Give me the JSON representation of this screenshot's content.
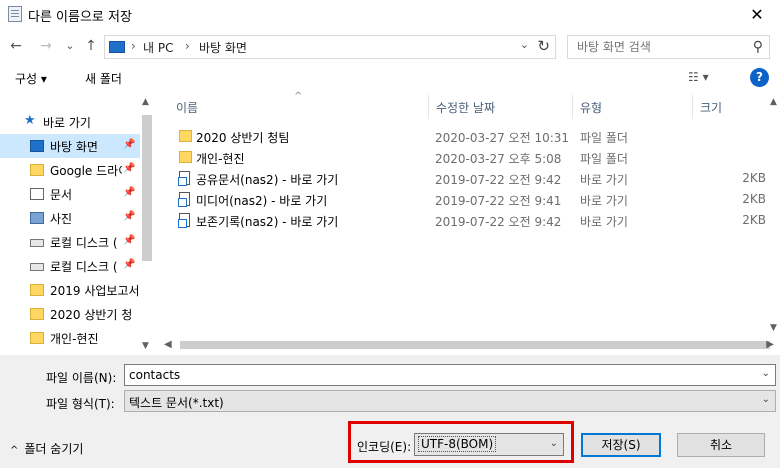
{
  "window": {
    "title": "다른 이름으로 저장",
    "close_glyph": "✕"
  },
  "nav": {
    "back": "←",
    "forward": "→",
    "recent": "⌄",
    "up": "↑",
    "breadcrumb": [
      "내 PC",
      "바탕 화면"
    ],
    "search_placeholder": "바탕 화면 검색"
  },
  "toolbar": {
    "organize": "구성 ▾",
    "new_folder": "새 폴더",
    "help": "?"
  },
  "sidebar": {
    "items": [
      {
        "label": "바로 가기",
        "icon": "quick-access-star-icon"
      },
      {
        "label": "바탕 화면",
        "icon": "desktop-icon",
        "selected": true
      },
      {
        "label": "Google 드라이",
        "icon": "folder-icon"
      },
      {
        "label": "문서",
        "icon": "documents-icon"
      },
      {
        "label": "사진",
        "icon": "pictures-icon"
      },
      {
        "label": "로컬 디스크 (",
        "icon": "drive-icon"
      },
      {
        "label": "로컬 디스크 (",
        "icon": "drive-icon"
      },
      {
        "label": "2019 사업보고서",
        "icon": "folder-icon"
      },
      {
        "label": "2020 상반기 청",
        "icon": "folder-icon"
      },
      {
        "label": "개인-현진",
        "icon": "folder-icon"
      }
    ]
  },
  "columns": {
    "name": "이름",
    "modified": "수정한 날짜",
    "type": "유형",
    "size": "크기"
  },
  "files": [
    {
      "name": "2020 상반기 청팀",
      "modified": "2020-03-27 오전 10:31",
      "type": "파일 폴더",
      "size": "",
      "icon": "folder-icon"
    },
    {
      "name": "개인-현진",
      "modified": "2020-03-27 오후 5:08",
      "type": "파일 폴더",
      "size": "",
      "icon": "folder-icon"
    },
    {
      "name": "공유문서(nas2) - 바로 가기",
      "modified": "2019-07-22 오전 9:42",
      "type": "바로 가기",
      "size": "2KB",
      "icon": "shortcut-icon"
    },
    {
      "name": "미디어(nas2) - 바로 가기",
      "modified": "2019-07-22 오전 9:41",
      "type": "바로 가기",
      "size": "2KB",
      "icon": "shortcut-icon"
    },
    {
      "name": "보존기록(nas2) - 바로 가기",
      "modified": "2019-07-22 오전 9:42",
      "type": "바로 가기",
      "size": "2KB",
      "icon": "shortcut-icon"
    }
  ],
  "form": {
    "filename_label": "파일 이름(N):",
    "filename_value": "contacts",
    "filetype_label": "파일 형식(T):",
    "filetype_value": "텍스트 문서(*.txt)",
    "hide_folders": "폴더 숨기기",
    "encoding_label": "인코딩(E):",
    "encoding_value": "UTF-8(BOM)",
    "save": "저장(S)",
    "cancel": "취소"
  },
  "colors": {
    "highlight": "#e00000",
    "selection": "#cce8ff",
    "accent": "#0078d7"
  }
}
